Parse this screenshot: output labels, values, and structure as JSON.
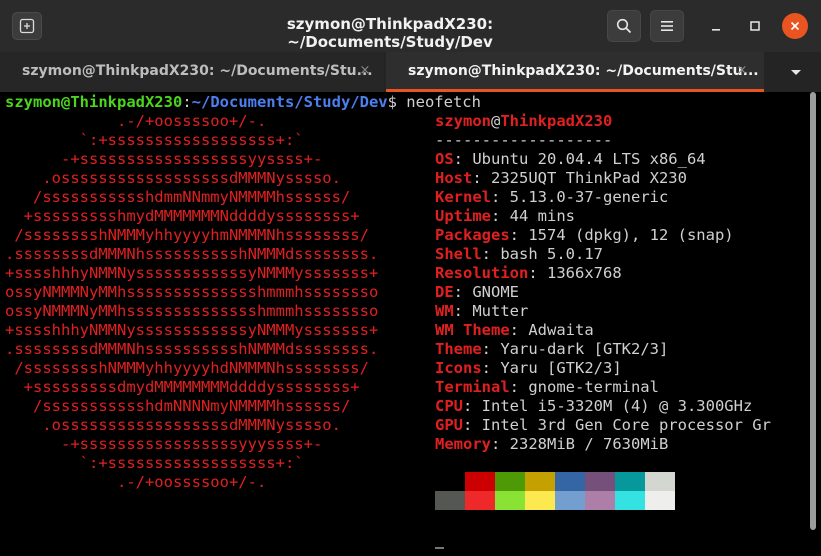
{
  "window": {
    "title": "szymon@ThinkpadX230: ~/Documents/Study/Dev",
    "accent": "#e95420"
  },
  "titlebar": {
    "new_tab_icon": "new-tab-icon",
    "search_icon": "search-icon",
    "menu_icon": "hamburger-menu-icon",
    "minimize_icon": "minimize-icon",
    "maximize_icon": "maximize-icon",
    "close_icon": "close-icon"
  },
  "tabs": [
    {
      "label": "szymon@ThinkpadX230: ~/Documents/Stu...",
      "close": "×",
      "active": false
    },
    {
      "label": "szymon@ThinkpadX230: ~/Documents/Stu...",
      "close": "×",
      "active": true
    }
  ],
  "prompt": {
    "user_host": "szymon@ThinkpadX230",
    "sep": ":",
    "path": "~/Documents/Study/Dev",
    "symbol": "$",
    "command": " neofetch"
  },
  "ascii_art": [
    "            .-/+oossssoo+/-.",
    "        `:+ssssssssssssssssss+:`",
    "      -+ssssssssssssssssssyyssss+-",
    "    .ossssssssssssssssssdMMMNysssso.",
    "   /ssssssssssshdmmNNmmyNMMMMhssssss/",
    "  +ssssssssshmydMMMMMMMNddddyssssssss+",
    " /sssssssshNMMMyhhyyyyhmNMMMNhssssssss/",
    ".ssssssssdMMMNhsssssssssshNMMMdssssssss.",
    "+sssshhhyNMMNyssssssssssssyNMMMysssssss+",
    "ossyNMMMNyMMhsssssssssssssshmmmhssssssso",
    "ossyNMMMNyMMhsssssssssssssshmmmhssssssso",
    "+sssshhhyNMMNyssssssssssssyNMMMysssssss+",
    ".ssssssssdMMMNhsssssssssshNMMMdssssssss.",
    " /sssssssshNMMMyhhyyyyhdNMMMNhssssssss/",
    "  +sssssssssdmydMMMMMMMMddddyssssssss+",
    "   /ssssssssssshdmNNNNmyNMMMMhssssss/",
    "    .ossssssssssssssssssdMMMNysssso.",
    "      -+sssssssssssssssssyyyssss+-",
    "        `:+ssssssssssssssssss+:`",
    "            .-/+oossssoo+/-."
  ],
  "info": {
    "user": "szymon",
    "at": "@",
    "host": "ThinkpadX230",
    "separator": "-------------------",
    "rows": [
      {
        "key": "OS",
        "value": "Ubuntu 20.04.4 LTS x86_64"
      },
      {
        "key": "Host",
        "value": "2325UQT ThinkPad X230"
      },
      {
        "key": "Kernel",
        "value": "5.13.0-37-generic"
      },
      {
        "key": "Uptime",
        "value": "44 mins"
      },
      {
        "key": "Packages",
        "value": "1574 (dpkg), 12 (snap)"
      },
      {
        "key": "Shell",
        "value": "bash 5.0.17"
      },
      {
        "key": "Resolution",
        "value": "1366x768"
      },
      {
        "key": "DE",
        "value": "GNOME"
      },
      {
        "key": "WM",
        "value": "Mutter"
      },
      {
        "key": "WM Theme",
        "value": "Adwaita"
      },
      {
        "key": "Theme",
        "value": "Yaru-dark [GTK2/3]"
      },
      {
        "key": "Icons",
        "value": "Yaru [GTK2/3]"
      },
      {
        "key": "Terminal",
        "value": "gnome-terminal"
      },
      {
        "key": "CPU",
        "value": "Intel i5-3320M (4) @ 3.300GHz"
      },
      {
        "key": "GPU",
        "value": "Intel 3rd Gen Core processor Gr"
      },
      {
        "key": "Memory",
        "value": "2328MiB / 7630MiB"
      }
    ],
    "colon": ": "
  },
  "palette": {
    "row1": [
      "#000000",
      "#cc0000",
      "#4e9a06",
      "#c4a000",
      "#3465a4",
      "#75507b",
      "#06989a",
      "#d3d7cf"
    ],
    "row2": [
      "#555753",
      "#ef2929",
      "#8ae234",
      "#fce94f",
      "#729fcf",
      "#ad7fa8",
      "#34e2e2",
      "#eeeeec"
    ]
  }
}
